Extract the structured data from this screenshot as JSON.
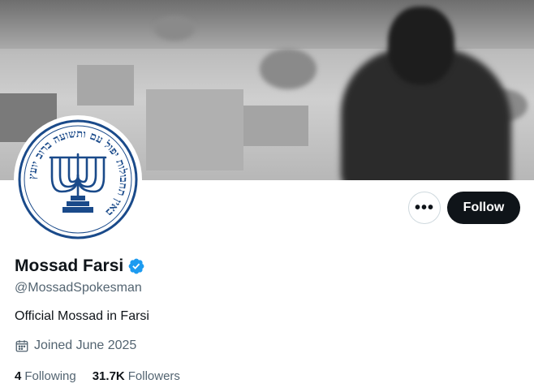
{
  "profile": {
    "display_name": "Mossad Farsi",
    "handle": "@MossadSpokesman",
    "bio": "Official Mossad in Farsi",
    "joined": "Joined June 2025",
    "verified": true,
    "avatar_ring_text": "באין תחבולות יפול עם ותשועה ברוב יועץ"
  },
  "actions": {
    "more_label": "•••",
    "follow_label": "Follow"
  },
  "stats": {
    "following_count": "4",
    "following_label": "Following",
    "followers_count": "31.7K",
    "followers_label": "Followers"
  },
  "icons": {
    "more": "more-horizontal-icon",
    "verified": "verified-badge-icon",
    "calendar": "calendar-icon",
    "menorah": "menorah-icon"
  },
  "colors": {
    "verified_blue": "#1d9bf0",
    "follow_button_bg": "#0f1419",
    "secondary_text": "#536471",
    "emblem_blue": "#1a4a8a"
  }
}
